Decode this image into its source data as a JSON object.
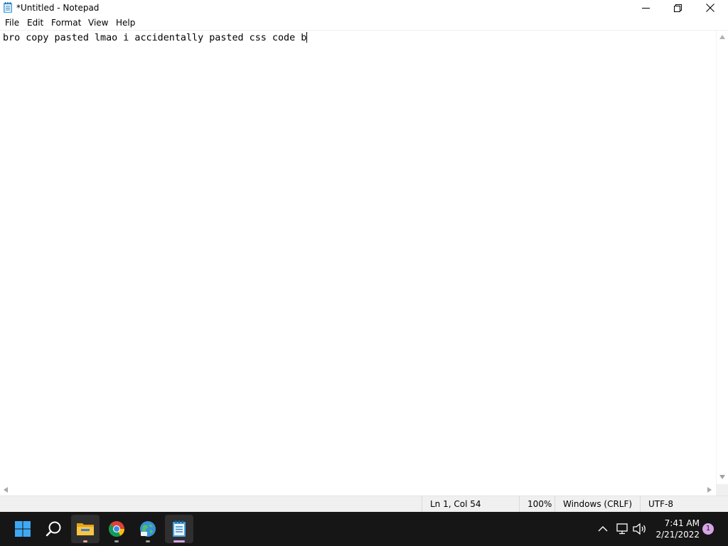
{
  "window": {
    "title": "*Untitled - Notepad",
    "icon": "notepad-icon",
    "controls": [
      "minimize-icon",
      "maximize-icon",
      "close-icon"
    ]
  },
  "menu": {
    "items": [
      {
        "label": "File"
      },
      {
        "label": "Edit"
      },
      {
        "label": "Format"
      },
      {
        "label": "View"
      },
      {
        "label": "Help"
      }
    ]
  },
  "editor": {
    "content": "bro copy pasted lmao i accidentally pasted css code b"
  },
  "status": {
    "position": "Ln 1, Col 54",
    "zoom": "100%",
    "line_ending": "Windows (CRLF)",
    "encoding": "UTF-8"
  },
  "taskbar": {
    "pinned": [
      {
        "name": "start-icon"
      },
      {
        "name": "search-icon"
      },
      {
        "name": "file-explorer-icon",
        "running": true
      },
      {
        "name": "chrome-icon",
        "running": true
      },
      {
        "name": "globe-app-icon",
        "running": true
      },
      {
        "name": "notepad-icon",
        "running": true,
        "active": true
      }
    ],
    "tray": [
      "chevron-up-icon",
      "network-icon",
      "volume-icon"
    ],
    "clock": {
      "time": "7:41 AM",
      "date": "2/21/2022"
    },
    "notification_count": "1"
  },
  "colors": {
    "taskbar_bg": "#161616",
    "status_bg": "#f0f0f0",
    "active_indicator": "#d8a4e8",
    "running_indicator": "#9a9a9a",
    "explorer_indicator": "#e8a09a"
  }
}
